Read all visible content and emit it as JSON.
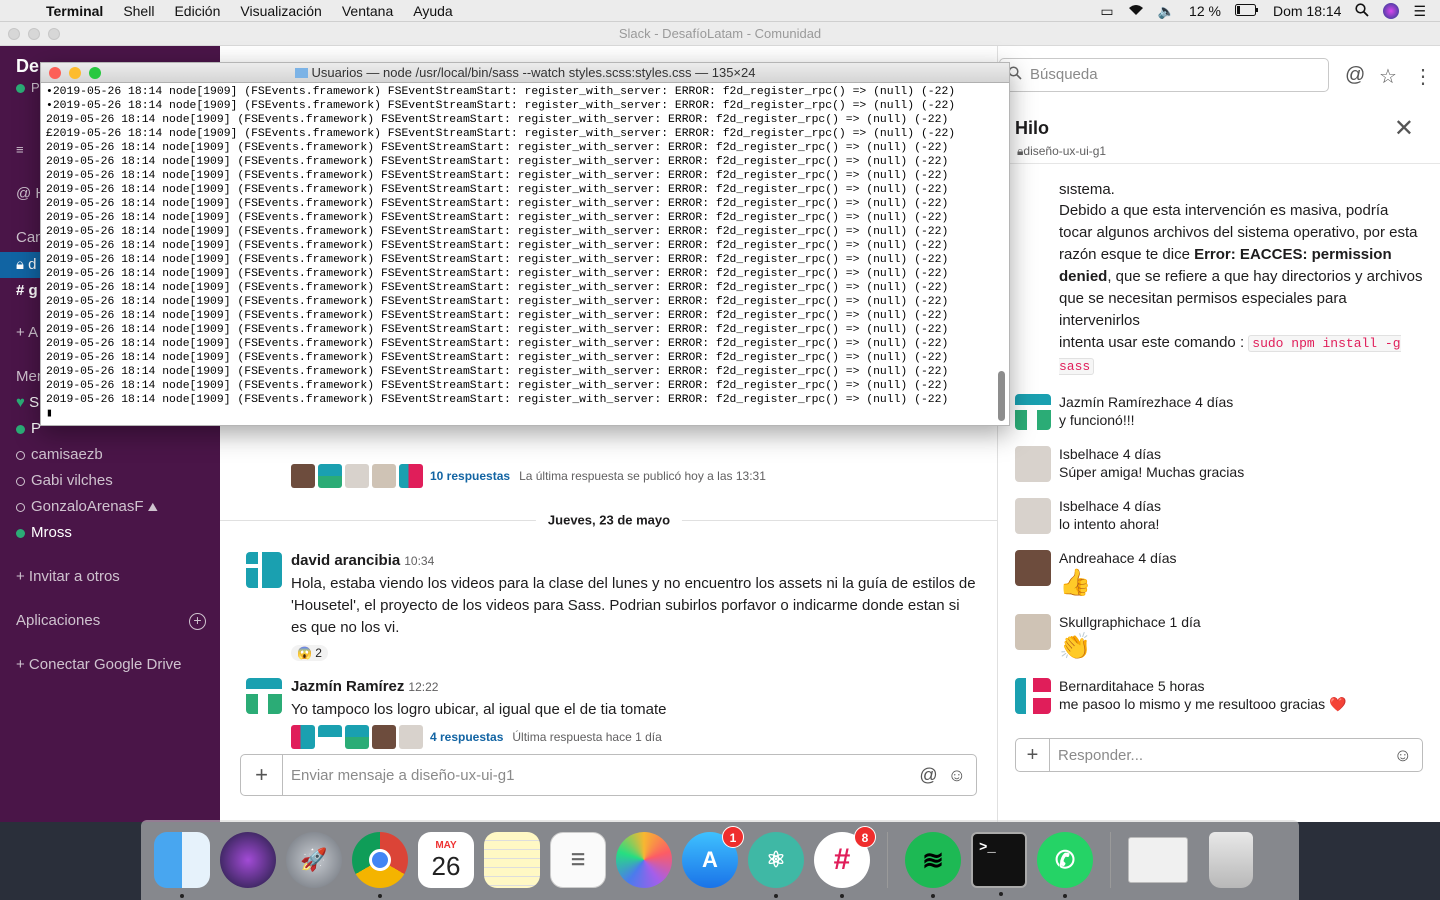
{
  "menubar": {
    "app": "Terminal",
    "items": [
      "Shell",
      "Edición",
      "Visualización",
      "Ventana",
      "Ayuda"
    ],
    "battery": "12 %",
    "clock": "Dom 18:14"
  },
  "slack": {
    "window_title": "Slack - DesafíoLatam - Comunidad",
    "workspace": "De",
    "sidebar": {
      "row_h": "H",
      "channels_heading": "Can",
      "channel_locked": "d",
      "channel_hash": "g",
      "add_channel": "+ A",
      "members_heading": "Men",
      "dm_s": "S",
      "dm_p": "P",
      "dm_names": [
        "camisaezb",
        "Gabi vilches",
        "GonzaloArenasF",
        "Mross"
      ],
      "invite": "+ Invitar a otros",
      "apps": "Aplicaciones",
      "gdrive": "+ Conectar Google Drive"
    },
    "main": {
      "thread_top": {
        "replies": "10 respuestas",
        "last": "La última respuesta se publicó hoy a las 13:31"
      },
      "day_separator": "Jueves, 23 de mayo",
      "messages": [
        {
          "name": "david arancibia",
          "time": "10:34",
          "text": "Hola, estaba viendo los videos para la clase del lunes y no encuentro los assets ni la guía de estilos de 'Housetel', el proyecto de los videos para Sass. Podrian subirlos porfavor o indicarme donde estan si es que no los vi.",
          "reaction": "😱",
          "reaction_count": "2"
        },
        {
          "name": "Jazmín Ramírez",
          "time": "12:22",
          "text": "Yo tampoco los logro ubicar, al igual que el de tia tomate",
          "replies": "4 respuestas",
          "last": "Última respuesta hace 1 día"
        }
      ],
      "composer_placeholder": "Enviar mensaje a diseño-ux-ui-g1"
    },
    "thread": {
      "search_placeholder": "Búsqueda",
      "title": "Hilo",
      "channel": "diseño-ux-ui-g1",
      "intro_fragment": "sistema.",
      "intro_a": "Debido a que esta intervención es masiva, podría tocar algunos archivos del sistema operativo, por esta razón esque te dice ",
      "intro_bold": "Error: EACCES: permission denied",
      "intro_b": ", que se refiere a que hay directorios y archivos que se necesitan permisos especiales para intervenirlos",
      "intro_c": "intenta usar este comando : ",
      "command": "sudo npm install -g sass",
      "replies": [
        {
          "name": "Jazmín Ramírez",
          "time": "hace 4 días",
          "text": "y funcionó!!!"
        },
        {
          "name": "Isbel",
          "time": "hace 4 días",
          "text": "Súper amiga! Muchas gracias"
        },
        {
          "name": "Isbel",
          "time": "hace 4 días",
          "text": "lo intento ahora!"
        },
        {
          "name": "Andrea",
          "time": "hace 4 días",
          "text": "👍"
        },
        {
          "name": "Skullgraphic",
          "time": "hace 1 día",
          "text": "👏"
        },
        {
          "name": "Bernardita",
          "time": "hace 5 horas",
          "text": "me pasoo lo mismo y me resultooo gracias ❤️"
        }
      ],
      "reply_placeholder": "Responder..."
    }
  },
  "terminal": {
    "title": "Usuarios — node /usr/local/bin/sass --watch styles.scss:styles.css — 135×24",
    "lines": [
      "•2019-05-26 18:14 node[1909] (FSEvents.framework) FSEventStreamStart: register_with_server: ERROR: f2d_register_rpc() => (null) (-22)",
      "•2019-05-26 18:14 node[1909] (FSEvents.framework) FSEventStreamStart: register_with_server: ERROR: f2d_register_rpc() => (null) (-22)",
      "2019-05-26 18:14 node[1909] (FSEvents.framework) FSEventStreamStart: register_with_server: ERROR: f2d_register_rpc() => (null) (-22)",
      "£2019-05-26 18:14 node[1909] (FSEvents.framework) FSEventStreamStart: register_with_server: ERROR: f2d_register_rpc() => (null) (-22)",
      "2019-05-26 18:14 node[1909] (FSEvents.framework) FSEventStreamStart: register_with_server: ERROR: f2d_register_rpc() => (null) (-22)",
      "2019-05-26 18:14 node[1909] (FSEvents.framework) FSEventStreamStart: register_with_server: ERROR: f2d_register_rpc() => (null) (-22)",
      "2019-05-26 18:14 node[1909] (FSEvents.framework) FSEventStreamStart: register_with_server: ERROR: f2d_register_rpc() => (null) (-22)",
      "2019-05-26 18:14 node[1909] (FSEvents.framework) FSEventStreamStart: register_with_server: ERROR: f2d_register_rpc() => (null) (-22)",
      "2019-05-26 18:14 node[1909] (FSEvents.framework) FSEventStreamStart: register_with_server: ERROR: f2d_register_rpc() => (null) (-22)",
      "2019-05-26 18:14 node[1909] (FSEvents.framework) FSEventStreamStart: register_with_server: ERROR: f2d_register_rpc() => (null) (-22)",
      "2019-05-26 18:14 node[1909] (FSEvents.framework) FSEventStreamStart: register_with_server: ERROR: f2d_register_rpc() => (null) (-22)",
      "2019-05-26 18:14 node[1909] (FSEvents.framework) FSEventStreamStart: register_with_server: ERROR: f2d_register_rpc() => (null) (-22)",
      "2019-05-26 18:14 node[1909] (FSEvents.framework) FSEventStreamStart: register_with_server: ERROR: f2d_register_rpc() => (null) (-22)",
      "2019-05-26 18:14 node[1909] (FSEvents.framework) FSEventStreamStart: register_with_server: ERROR: f2d_register_rpc() => (null) (-22)",
      "2019-05-26 18:14 node[1909] (FSEvents.framework) FSEventStreamStart: register_with_server: ERROR: f2d_register_rpc() => (null) (-22)",
      "2019-05-26 18:14 node[1909] (FSEvents.framework) FSEventStreamStart: register_with_server: ERROR: f2d_register_rpc() => (null) (-22)",
      "2019-05-26 18:14 node[1909] (FSEvents.framework) FSEventStreamStart: register_with_server: ERROR: f2d_register_rpc() => (null) (-22)",
      "2019-05-26 18:14 node[1909] (FSEvents.framework) FSEventStreamStart: register_with_server: ERROR: f2d_register_rpc() => (null) (-22)",
      "2019-05-26 18:14 node[1909] (FSEvents.framework) FSEventStreamStart: register_with_server: ERROR: f2d_register_rpc() => (null) (-22)",
      "2019-05-26 18:14 node[1909] (FSEvents.framework) FSEventStreamStart: register_with_server: ERROR: f2d_register_rpc() => (null) (-22)",
      "2019-05-26 18:14 node[1909] (FSEvents.framework) FSEventStreamStart: register_with_server: ERROR: f2d_register_rpc() => (null) (-22)",
      "2019-05-26 18:14 node[1909] (FSEvents.framework) FSEventStreamStart: register_with_server: ERROR: f2d_register_rpc() => (null) (-22)",
      "2019-05-26 18:14 node[1909] (FSEvents.framework) FSEventStreamStart: register_with_server: ERROR: f2d_register_rpc() => (null) (-22)",
      "▮"
    ]
  },
  "dock": {
    "calendar_month": "MAY",
    "calendar_day": "26",
    "appstore_badge": "1",
    "slack_badge": "8"
  },
  "colors": {
    "sidebar_bg": "#4a1548",
    "link": "#1264a3",
    "online": "#2bac76",
    "code": "#e01e5a"
  }
}
